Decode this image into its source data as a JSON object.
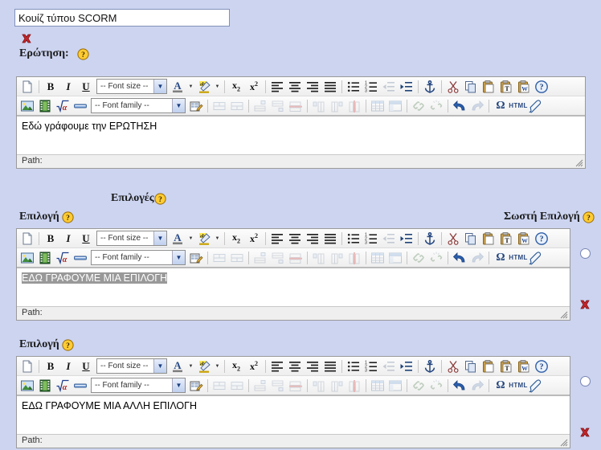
{
  "page": {
    "background_color": "#ccd4f0",
    "title_field": {
      "value": "Κουίζ τύπου SCORM",
      "placeholder": ""
    }
  },
  "question_section": {
    "delete_icon": "delete-x-icon",
    "label": "Ερώτηση:",
    "help_icon": "help-question-icon",
    "editor": {
      "content": "Εδώ γράφουμε την ΕΡΩΤΗΣΗ",
      "status_label": "Path:",
      "selected": false
    }
  },
  "options_header": {
    "label": "Επιλογές",
    "help_icon": "help-question-icon"
  },
  "choices": [
    {
      "label": "Επιλογή",
      "help_icon": "help-question-icon",
      "correct_label": "Σωστή Επιλογή",
      "correct_help_icon": "help-question-icon",
      "radio_name": "correct-choice-radio",
      "radio_checked": false,
      "delete_icon": "delete-x-icon",
      "editor": {
        "content": "ΕΔΩ ΓΡΑΦΟΥΜΕ ΜΙΑ ΕΠΙΛΟΓΗ",
        "status_label": "Path:",
        "selected": true
      }
    },
    {
      "label": "Επιλογή",
      "help_icon": "help-question-icon",
      "correct_label": "",
      "correct_help_icon": "",
      "radio_name": "correct-choice-radio",
      "radio_checked": false,
      "delete_icon": "delete-x-icon",
      "editor": {
        "content": "ΕΔΩ ΓΡΑΦΟΥΜΕ ΜΙΑ ΑΛΛΗ ΕΠΙΛΟΓΗ",
        "status_label": "Path:",
        "selected": false
      }
    }
  ],
  "toolbar": {
    "row1": [
      {
        "name": "new-document-icon",
        "type": "btn",
        "label": ""
      },
      {
        "name": "separator",
        "type": "sep",
        "label": ""
      },
      {
        "name": "bold-icon",
        "type": "btn",
        "label": "B"
      },
      {
        "name": "italic-icon",
        "type": "btn",
        "label": "I"
      },
      {
        "name": "underline-icon",
        "type": "btn",
        "label": "U"
      },
      {
        "name": "font-size-select",
        "type": "combo",
        "label": "-- Font size --"
      },
      {
        "name": "text-color-icon",
        "type": "btn",
        "label": "A"
      },
      {
        "name": "text-color-arrow",
        "type": "arrow",
        "label": ""
      },
      {
        "name": "highlight-color-icon",
        "type": "btn",
        "label": "ab"
      },
      {
        "name": "highlight-color-arrow",
        "type": "arrow",
        "label": ""
      },
      {
        "name": "separator",
        "type": "sep",
        "label": ""
      },
      {
        "name": "subscript-icon",
        "type": "btn",
        "label": "x2"
      },
      {
        "name": "superscript-icon",
        "type": "btn",
        "label": "x2"
      },
      {
        "name": "separator",
        "type": "sep",
        "label": ""
      },
      {
        "name": "align-left-icon",
        "type": "btn",
        "label": ""
      },
      {
        "name": "align-center-icon",
        "type": "btn",
        "label": ""
      },
      {
        "name": "align-right-icon",
        "type": "btn",
        "label": ""
      },
      {
        "name": "align-justify-icon",
        "type": "btn",
        "label": ""
      },
      {
        "name": "separator",
        "type": "sep",
        "label": ""
      },
      {
        "name": "bullet-list-icon",
        "type": "btn",
        "label": ""
      },
      {
        "name": "numbered-list-icon",
        "type": "btn",
        "label": ""
      },
      {
        "name": "outdent-icon",
        "type": "btn",
        "label": ""
      },
      {
        "name": "indent-icon",
        "type": "btn",
        "label": ""
      },
      {
        "name": "separator",
        "type": "sep",
        "label": ""
      },
      {
        "name": "anchor-icon",
        "type": "btn",
        "label": ""
      },
      {
        "name": "separator",
        "type": "sep",
        "label": ""
      },
      {
        "name": "cut-icon",
        "type": "btn",
        "label": ""
      },
      {
        "name": "copy-icon",
        "type": "btn",
        "label": ""
      },
      {
        "name": "paste-icon",
        "type": "btn",
        "label": ""
      },
      {
        "name": "paste-text-icon",
        "type": "btn",
        "label": ""
      },
      {
        "name": "paste-word-icon",
        "type": "btn",
        "label": ""
      },
      {
        "name": "help-circle-icon",
        "type": "btn",
        "label": ""
      }
    ],
    "row2": [
      {
        "name": "insert-image-icon",
        "type": "btn",
        "label": ""
      },
      {
        "name": "insert-media-icon",
        "type": "btn",
        "label": ""
      },
      {
        "name": "insert-equation-icon",
        "type": "btn",
        "label": ""
      },
      {
        "name": "horizontal-rule-icon",
        "type": "btn",
        "label": ""
      },
      {
        "name": "font-family-select",
        "type": "combo",
        "label": "-- Font family --"
      },
      {
        "name": "edit-html-source-icon",
        "type": "btn",
        "label": ""
      },
      {
        "name": "separator",
        "type": "sep",
        "label": ""
      },
      {
        "name": "merge-cells-icon",
        "type": "btn",
        "label": ""
      },
      {
        "name": "split-cells-icon",
        "type": "btn",
        "label": ""
      },
      {
        "name": "separator",
        "type": "sep",
        "label": ""
      },
      {
        "name": "insert-row-before-icon",
        "type": "btn",
        "label": ""
      },
      {
        "name": "insert-row-after-icon",
        "type": "btn",
        "label": ""
      },
      {
        "name": "delete-row-icon",
        "type": "btn",
        "label": ""
      },
      {
        "name": "separator",
        "type": "sep",
        "label": ""
      },
      {
        "name": "insert-col-before-icon",
        "type": "btn",
        "label": ""
      },
      {
        "name": "insert-col-after-icon",
        "type": "btn",
        "label": ""
      },
      {
        "name": "delete-col-icon",
        "type": "btn",
        "label": ""
      },
      {
        "name": "separator",
        "type": "sep",
        "label": ""
      },
      {
        "name": "insert-table-icon",
        "type": "btn",
        "label": ""
      },
      {
        "name": "table-properties-icon",
        "type": "btn",
        "label": ""
      },
      {
        "name": "separator",
        "type": "sep",
        "label": ""
      },
      {
        "name": "insert-link-icon",
        "type": "btn",
        "label": ""
      },
      {
        "name": "unlink-icon",
        "type": "btn",
        "label": ""
      },
      {
        "name": "separator",
        "type": "sep",
        "label": ""
      },
      {
        "name": "undo-icon",
        "type": "btn",
        "label": ""
      },
      {
        "name": "redo-icon",
        "type": "btn",
        "label": ""
      },
      {
        "name": "separator",
        "type": "sep",
        "label": ""
      },
      {
        "name": "special-char-icon",
        "type": "btn",
        "label": "Ω"
      },
      {
        "name": "html-source-icon",
        "type": "btn",
        "label": "HTML"
      },
      {
        "name": "cleanup-icon",
        "type": "btn",
        "label": ""
      }
    ]
  }
}
